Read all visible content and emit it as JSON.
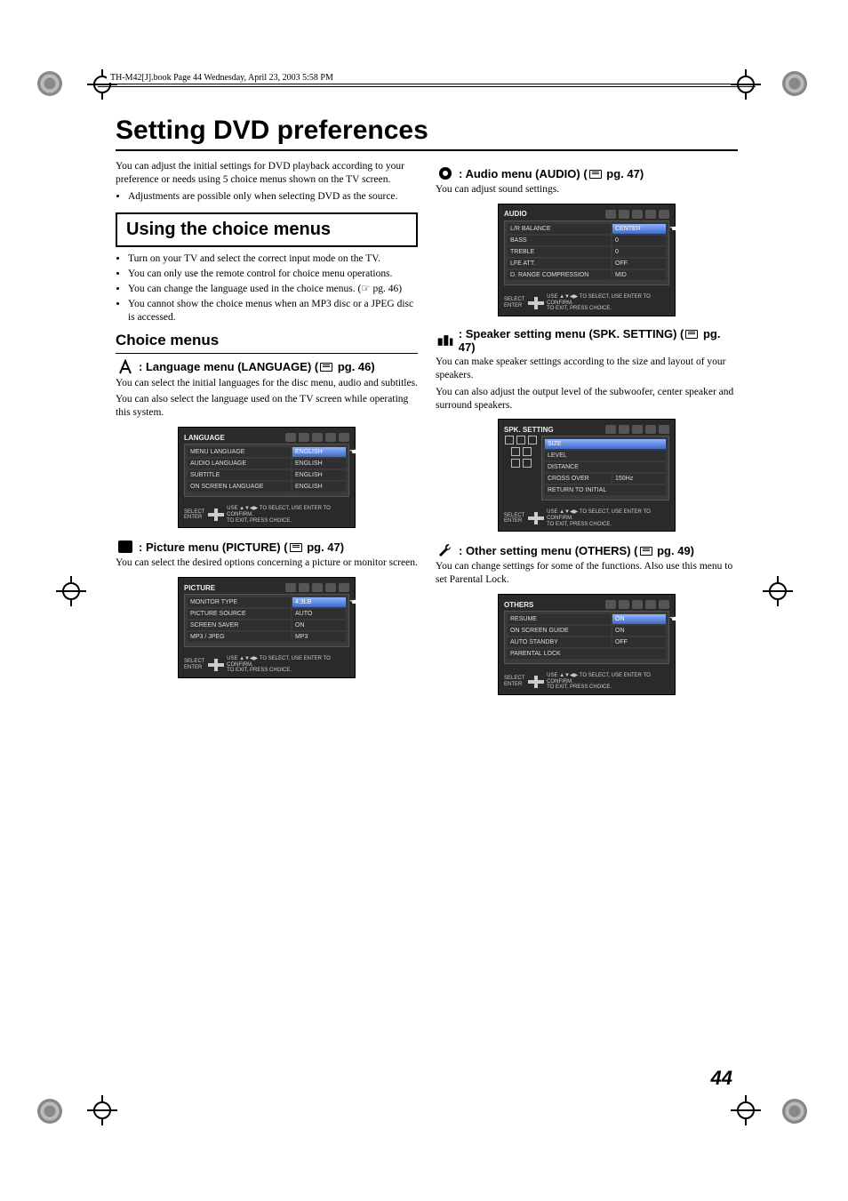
{
  "header": "TH-M42[J].book  Page 44  Wednesday, April 23, 2003  5:58 PM",
  "page_number": "44",
  "title": "Setting DVD preferences",
  "intro_para": "You can adjust the initial settings for DVD playback according to your preference or needs using 5 choice menus shown on the TV screen.",
  "intro_bullets": [
    "Adjustments are possible only when selecting DVD as the source."
  ],
  "boxed_heading": "Using the choice menus",
  "boxed_bullets": [
    "Turn on your TV and select the correct input mode on the TV.",
    "You can only use the remote control for choice menu operations.",
    "You can change the language used in the choice menus. (☞ pg. 46)",
    "You cannot show the choice menus when an MP3 disc or a JPEG disc is accessed."
  ],
  "choice_menus_heading": "Choice menus",
  "sections": {
    "language": {
      "heading_pre": ": Language menu (LANGUAGE) (",
      "heading_ref": " pg. 46)",
      "para1": "You can select the initial languages for the disc menu, audio and subtitles.",
      "para2": "You can also select the language used on the TV screen while operating this system.",
      "menu_title": "LANGUAGE",
      "rows": [
        {
          "k": "MENU LANGUAGE",
          "v": "ENGLISH",
          "hl": true
        },
        {
          "k": "AUDIO LANGUAGE",
          "v": "ENGLISH"
        },
        {
          "k": "SUBTITLE",
          "v": "ENGLISH"
        },
        {
          "k": "ON SCREEN LANGUAGE",
          "v": "ENGLISH"
        }
      ]
    },
    "picture": {
      "heading_pre": ": Picture menu (PICTURE) (",
      "heading_ref": " pg. 47)",
      "para1": "You can select the desired options concerning a picture or monitor screen.",
      "menu_title": "PICTURE",
      "rows": [
        {
          "k": "MONITOR TYPE",
          "v": "4:3LB",
          "hl": true
        },
        {
          "k": "PICTURE SOURCE",
          "v": "AUTO"
        },
        {
          "k": "SCREEN SAVER",
          "v": "ON"
        },
        {
          "k": "MP3 / JPEG",
          "v": "MP3"
        }
      ]
    },
    "audio": {
      "heading_pre": ": Audio menu (AUDIO) (",
      "heading_ref": " pg. 47)",
      "para1": "You can adjust sound settings.",
      "menu_title": "AUDIO",
      "rows": [
        {
          "k": "L/R BALANCE",
          "v": "CENTER",
          "hl": true
        },
        {
          "k": "BASS",
          "v": "0"
        },
        {
          "k": "TREBLE",
          "v": "0"
        },
        {
          "k": "LFE ATT.",
          "v": "OFF"
        },
        {
          "k": "D. RANGE COMPRESSION",
          "v": "MID"
        }
      ]
    },
    "spk": {
      "heading_pre": ": Speaker setting menu (SPK. SETTING) (",
      "heading_ref": " pg. 47)",
      "para1": "You can make speaker settings according to the size and layout of your speakers.",
      "para2": "You can also adjust the output level of the subwoofer, center speaker and surround speakers.",
      "menu_title": "SPK. SETTING",
      "rows": [
        {
          "k": "SIZE",
          "hl": true
        },
        {
          "k": "LEVEL"
        },
        {
          "k": "DISTANCE"
        },
        {
          "k": "CROSS OVER",
          "v": "150Hz"
        },
        {
          "k": "RETURN TO INITIAL"
        }
      ]
    },
    "others": {
      "heading_pre": ": Other setting menu (OTHERS) (",
      "heading_ref": " pg. 49)",
      "para1": "You can change settings for some of the functions. Also use this menu to set Parental Lock.",
      "menu_title": "OTHERS",
      "rows": [
        {
          "k": "RESUME",
          "v": "ON",
          "hl": true
        },
        {
          "k": "ON SCREEN GUIDE",
          "v": "ON"
        },
        {
          "k": "AUTO STANDBY",
          "v": "OFF"
        },
        {
          "k": "PARENTAL LOCK"
        }
      ]
    }
  },
  "footer": {
    "select": "SELECT",
    "enter": "ENTER",
    "hint1": "USE ▲▼◀▶ TO SELECT,  USE ENTER TO CONFIRM.",
    "hint2": "TO EXIT, PRESS CHOICE."
  }
}
